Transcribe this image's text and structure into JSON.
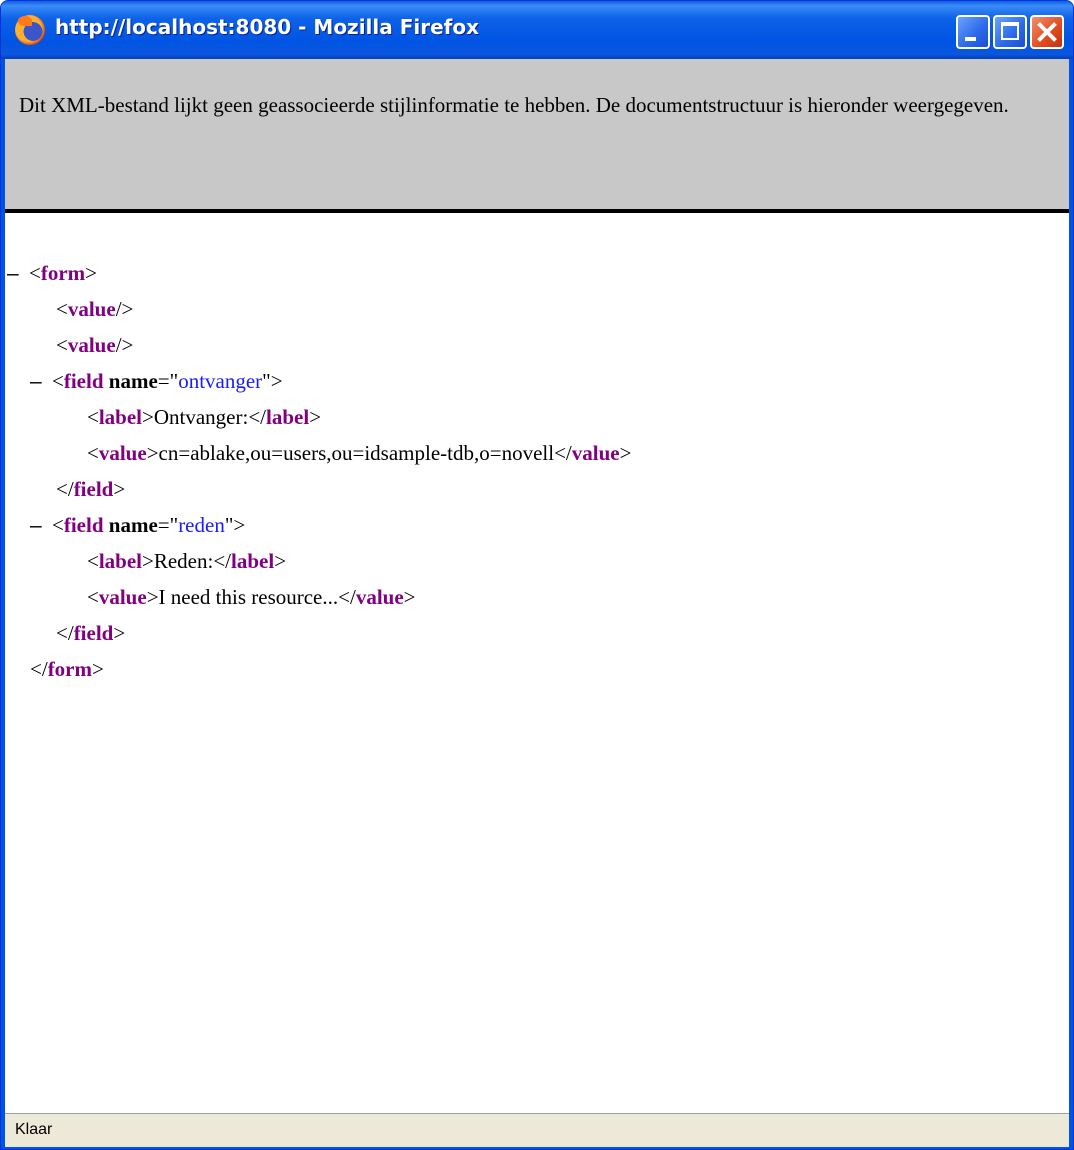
{
  "window": {
    "title": "http://localhost:8080 - Mozilla Firefox"
  },
  "header": {
    "message": "Dit XML-bestand lijkt geen geassocieerde stijlinformatie te hebben.  De documentstructuur is hieronder weergegeven."
  },
  "xml": {
    "collapse_glyph": "–",
    "lt": "<",
    "gt": ">",
    "close_lt": "</",
    "self_close": "/>",
    "equals_quote": "=\"",
    "quote_gt": "\">",
    "form_tag": "form",
    "value_tag": "value",
    "field_tag": "field",
    "label_tag": "label",
    "name_attr": "name",
    "field1_name": "ontvanger",
    "field1_label": "Ontvanger:",
    "field1_value": "cn=ablake,ou=users,ou=idsample-tdb,o=novell",
    "field2_name": "reden",
    "field2_label": "Reden:",
    "field2_value": "I need this resource..."
  },
  "status": {
    "text": "Klaar"
  }
}
